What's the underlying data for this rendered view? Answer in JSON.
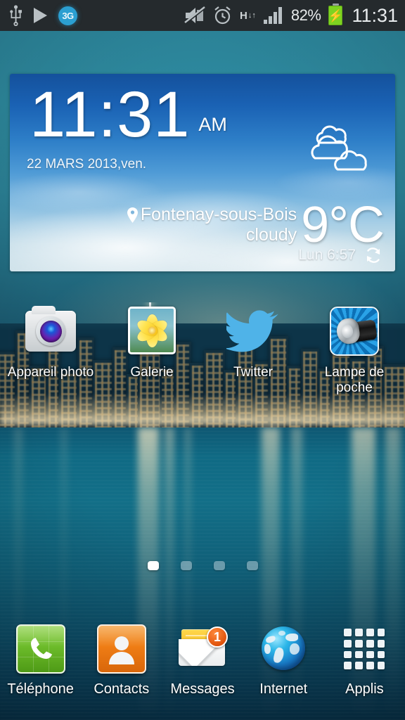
{
  "status_bar": {
    "left_icons": [
      {
        "name": "usb-icon",
        "label": "USB"
      },
      {
        "name": "media-play-icon",
        "label": "Play"
      },
      {
        "name": "network-3g-icon",
        "label": "3G"
      }
    ],
    "right_icons": [
      {
        "name": "mute-icon",
        "label": "Mute"
      },
      {
        "name": "alarm-icon",
        "label": "Alarm"
      },
      {
        "name": "hspa-data-icon",
        "label": "H"
      }
    ],
    "network_type": "3G",
    "hspa_letter": "H",
    "battery_percent": "82%",
    "battery_charging": true,
    "clock": "11:31"
  },
  "widget": {
    "name": "clock-weather-widget",
    "time": "11:31",
    "meridiem": "AM",
    "date": "22 MARS 2013,ven.",
    "location": "Fontenay-sous-Bois",
    "condition": "cloudy",
    "temperature": "9",
    "degree_unit": "°C",
    "updated": "Lun 6:57",
    "weather_icon": "cloudy-icon",
    "refresh_icon": "refresh-icon",
    "location_pin_icon": "location-pin-icon"
  },
  "home_apps": [
    {
      "label": "Appareil photo",
      "icon": "camera-icon",
      "name": "app-camera"
    },
    {
      "label": "Galerie",
      "icon": "gallery-icon",
      "name": "app-gallery"
    },
    {
      "label": "Twitter",
      "icon": "twitter-icon",
      "name": "app-twitter"
    },
    {
      "label": "Lampe de poche",
      "icon": "flashlight-icon",
      "name": "app-flashlight"
    }
  ],
  "page_indicator": {
    "total": 4,
    "active_index": 0
  },
  "dock": [
    {
      "label": "Téléphone",
      "icon": "phone-icon",
      "name": "dock-phone",
      "badge": null
    },
    {
      "label": "Contacts",
      "icon": "contacts-icon",
      "name": "dock-contacts",
      "badge": null
    },
    {
      "label": "Messages",
      "icon": "messages-icon",
      "name": "dock-messages",
      "badge": "1"
    },
    {
      "label": "Internet",
      "icon": "globe-icon",
      "name": "dock-internet",
      "badge": null
    },
    {
      "label": "Applis",
      "icon": "apps-grid-icon",
      "name": "dock-apps",
      "badge": null
    }
  ],
  "colors": {
    "status_bar_bg": "#252a2d",
    "accent_3g": "#2b9fd1",
    "battery_green": "#7ed321",
    "badge_orange": "#e0530c",
    "twitter_blue": "#4fb3e8",
    "phone_green": "#6cbb2a",
    "contacts_orange": "#ef7d15"
  }
}
